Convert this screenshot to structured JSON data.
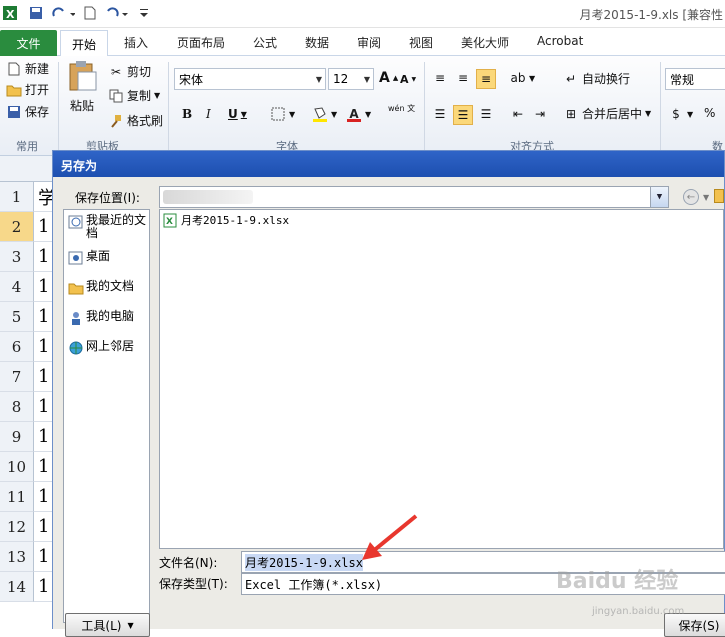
{
  "window": {
    "title": "月考2015-1-9.xls  [兼容性"
  },
  "ribbon_tabs": [
    "文件",
    "开始",
    "插入",
    "页面布局",
    "公式",
    "数据",
    "审阅",
    "视图",
    "美化大师",
    "Acrobat"
  ],
  "ribbon": {
    "groups": {
      "common": "常用",
      "clipboard": "剪贴板",
      "font": "字体",
      "alignment": "对齐方式",
      "number": "数"
    },
    "new": "新建",
    "open": "打开",
    "save": "保存",
    "paste": "粘贴",
    "cut": "剪切",
    "copy": "复制",
    "format_painter": "格式刷",
    "font_name": "宋体",
    "font_size": "12",
    "wrap": "自动换行",
    "merge": "合并后居中",
    "number_format": "常规",
    "percent": "%",
    "font_color_letter": "A",
    "bold": "B",
    "italic": "I",
    "underline": "U",
    "phonetic": "wén 文",
    "grow_font": "A",
    "shrink_font": "A"
  },
  "sheet": {
    "rows": [
      "1",
      "2",
      "3",
      "4",
      "5",
      "6",
      "7",
      "8",
      "9",
      "10",
      "11",
      "12",
      "13",
      "14"
    ],
    "cells": [
      "学",
      "1",
      "1",
      "1",
      "1",
      "1",
      "1",
      "1",
      "1",
      "1",
      "1",
      "1",
      "1",
      "1"
    ]
  },
  "dialog": {
    "title": "另存为",
    "save_in_label": "保存位置(I):",
    "places": [
      "我最近的文档",
      "桌面",
      "我的文档",
      "我的电脑",
      "网上邻居"
    ],
    "files": [
      "月考2015-1-9.xlsx"
    ],
    "filename_label": "文件名(N):",
    "filename_value": "月考2015-1-9.xlsx",
    "filetype_label": "保存类型(T):",
    "filetype_value": "Excel 工作簿(*.xlsx)",
    "tools_button": "工具(L)",
    "save_button": "保存(S)"
  },
  "watermark": {
    "text": "Baidu 经验",
    "url": "jingyan.baidu.com"
  },
  "colors": {
    "file_tab": "#2a8c3e",
    "dialog_title": "#1d4fb0",
    "arrow": "#e8372e",
    "selected": "#fbd87a"
  }
}
